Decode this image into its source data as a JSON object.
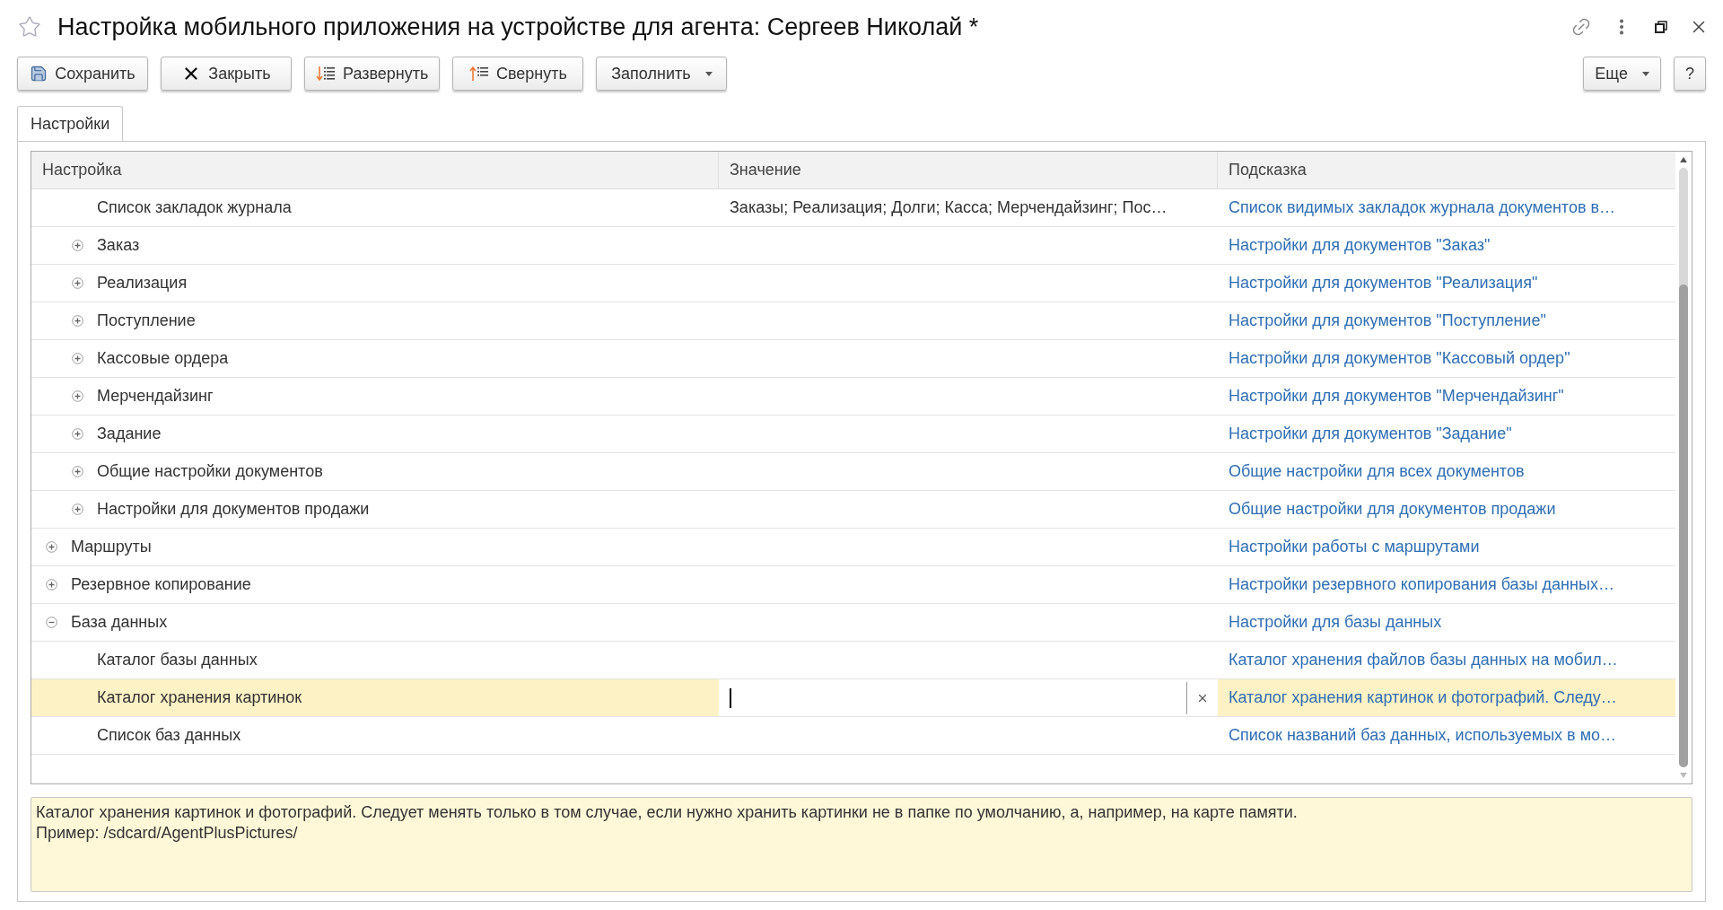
{
  "window": {
    "title": "Настройка мобильного приложения на устройстве для агента: Сергеев Николай *"
  },
  "toolbar": {
    "buttons": [
      {
        "kind": "save",
        "label": "Сохранить"
      },
      {
        "kind": "close",
        "label": "Закрыть"
      },
      {
        "kind": "expand",
        "label": "Развернуть"
      },
      {
        "kind": "collapse",
        "label": "Свернуть"
      },
      {
        "kind": "menu",
        "label": "Заполнить"
      }
    ],
    "right_buttons": [
      {
        "kind": "menu",
        "label": "Еще"
      },
      {
        "kind": "plain",
        "label": "?"
      }
    ]
  },
  "tabs": [
    {
      "label": "Настройки",
      "selected": true
    }
  ],
  "table": {
    "columns": [
      "Настройка",
      "Значение",
      "Подсказка"
    ],
    "tree": [
      {
        "children": [
          {
            "label": "Список закладок журнала",
            "value": "Заказы; Реализация; Долги; Касса; Мерчендайзинг; Пос…",
            "hint": "Список видимых закладок журнала документов в…",
            "selected": false
          },
          {
            "label": "Заказ",
            "hint": "Настройки для документов \"Заказ\"",
            "expanded": false,
            "selected": false
          },
          {
            "label": "Реализация",
            "hint": "Настройки для документов \"Реализация\"",
            "expanded": false,
            "selected": false
          },
          {
            "label": "Поступление",
            "hint": "Настройки для документов \"Поступление\"",
            "expanded": false,
            "selected": false
          },
          {
            "label": "Кассовые ордера",
            "hint": "Настройки для документов \"Кассовый ордер\"",
            "expanded": false,
            "selected": false
          },
          {
            "label": "Мерчендайзинг",
            "hint": "Настройки для документов \"Мерчендайзинг\"",
            "expanded": false,
            "selected": false
          },
          {
            "label": "Задание",
            "hint": "Настройки для документов \"Задание\"",
            "expanded": false,
            "selected": false
          },
          {
            "label": "Общие настройки документов",
            "hint": "Общие настройки для всех документов",
            "expanded": false,
            "selected": false
          },
          {
            "label": "Настройки для документов продажи",
            "hint": "Общие настройки для документов продажи",
            "expanded": false,
            "selected": false
          }
        ]
      },
      {
        "label": "Маршруты",
        "hint": "Настройки работы с маршрутами",
        "expanded": false,
        "selected": false
      },
      {
        "label": "Резервное копирование",
        "hint": "Настройки резервного копирования базы данных…",
        "expanded": false,
        "selected": false
      },
      {
        "label": "База данных",
        "hint": "Настройки для базы данных",
        "expanded": true,
        "selected": false,
        "children": [
          {
            "label": "Каталог базы данных",
            "hint": "Каталог хранения файлов базы данных на мобил…",
            "selected": false
          },
          {
            "label": "Каталог хранения картинок",
            "hint": "Каталог хранения картинок и фотографий. Следу…",
            "selected": true
          },
          {
            "label": "Список баз данных",
            "hint": "Список названий баз данных, используемых в мо…",
            "selected": false
          }
        ]
      }
    ]
  },
  "description": {
    "lines": [
      "Каталог хранения картинок и фотографий. Следует менять только в том случае, если нужно хранить картинки не в папке по умолчанию, а, например, на карте памяти.",
      "Пример: /sdcard/AgentPlusPictures/"
    ]
  }
}
